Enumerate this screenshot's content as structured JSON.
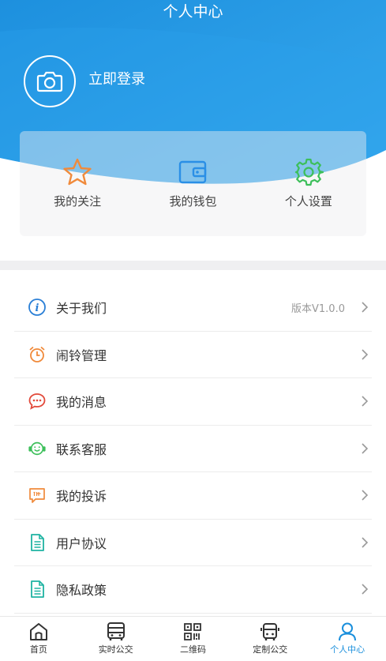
{
  "header": {
    "title": "个人中心",
    "login_label": "立即登录",
    "avatar_icon": "camera-icon",
    "accent_color": "#2196e3"
  },
  "quick_actions": [
    {
      "label": "我的关注",
      "icon": "star-icon",
      "color": "#f08a3b"
    },
    {
      "label": "我的钱包",
      "icon": "wallet-icon",
      "color": "#2a8fe6"
    },
    {
      "label": "个人设置",
      "icon": "gear-icon",
      "color": "#3cbf5a"
    }
  ],
  "menu": [
    {
      "label": "关于我们",
      "icon": "info-icon",
      "right_text": "版本V1.0.0"
    },
    {
      "label": "闹铃管理",
      "icon": "alarm-clock-icon",
      "right_text": ""
    },
    {
      "label": "我的消息",
      "icon": "message-icon",
      "right_text": ""
    },
    {
      "label": "联系客服",
      "icon": "headset-icon",
      "right_text": ""
    },
    {
      "label": "我的投诉",
      "icon": "complaint-icon",
      "right_text": ""
    },
    {
      "label": "用户协议",
      "icon": "document-icon",
      "right_text": ""
    },
    {
      "label": "隐私政策",
      "icon": "document-icon",
      "right_text": ""
    }
  ],
  "tabbar": [
    {
      "label": "首页",
      "icon": "home-icon",
      "active": false
    },
    {
      "label": "实时公交",
      "icon": "bus-icon",
      "active": false
    },
    {
      "label": "二维码",
      "icon": "qrcode-icon",
      "active": false
    },
    {
      "label": "定制公交",
      "icon": "custom-bus-icon",
      "active": false
    },
    {
      "label": "个人中心",
      "icon": "user-icon",
      "active": true
    }
  ]
}
